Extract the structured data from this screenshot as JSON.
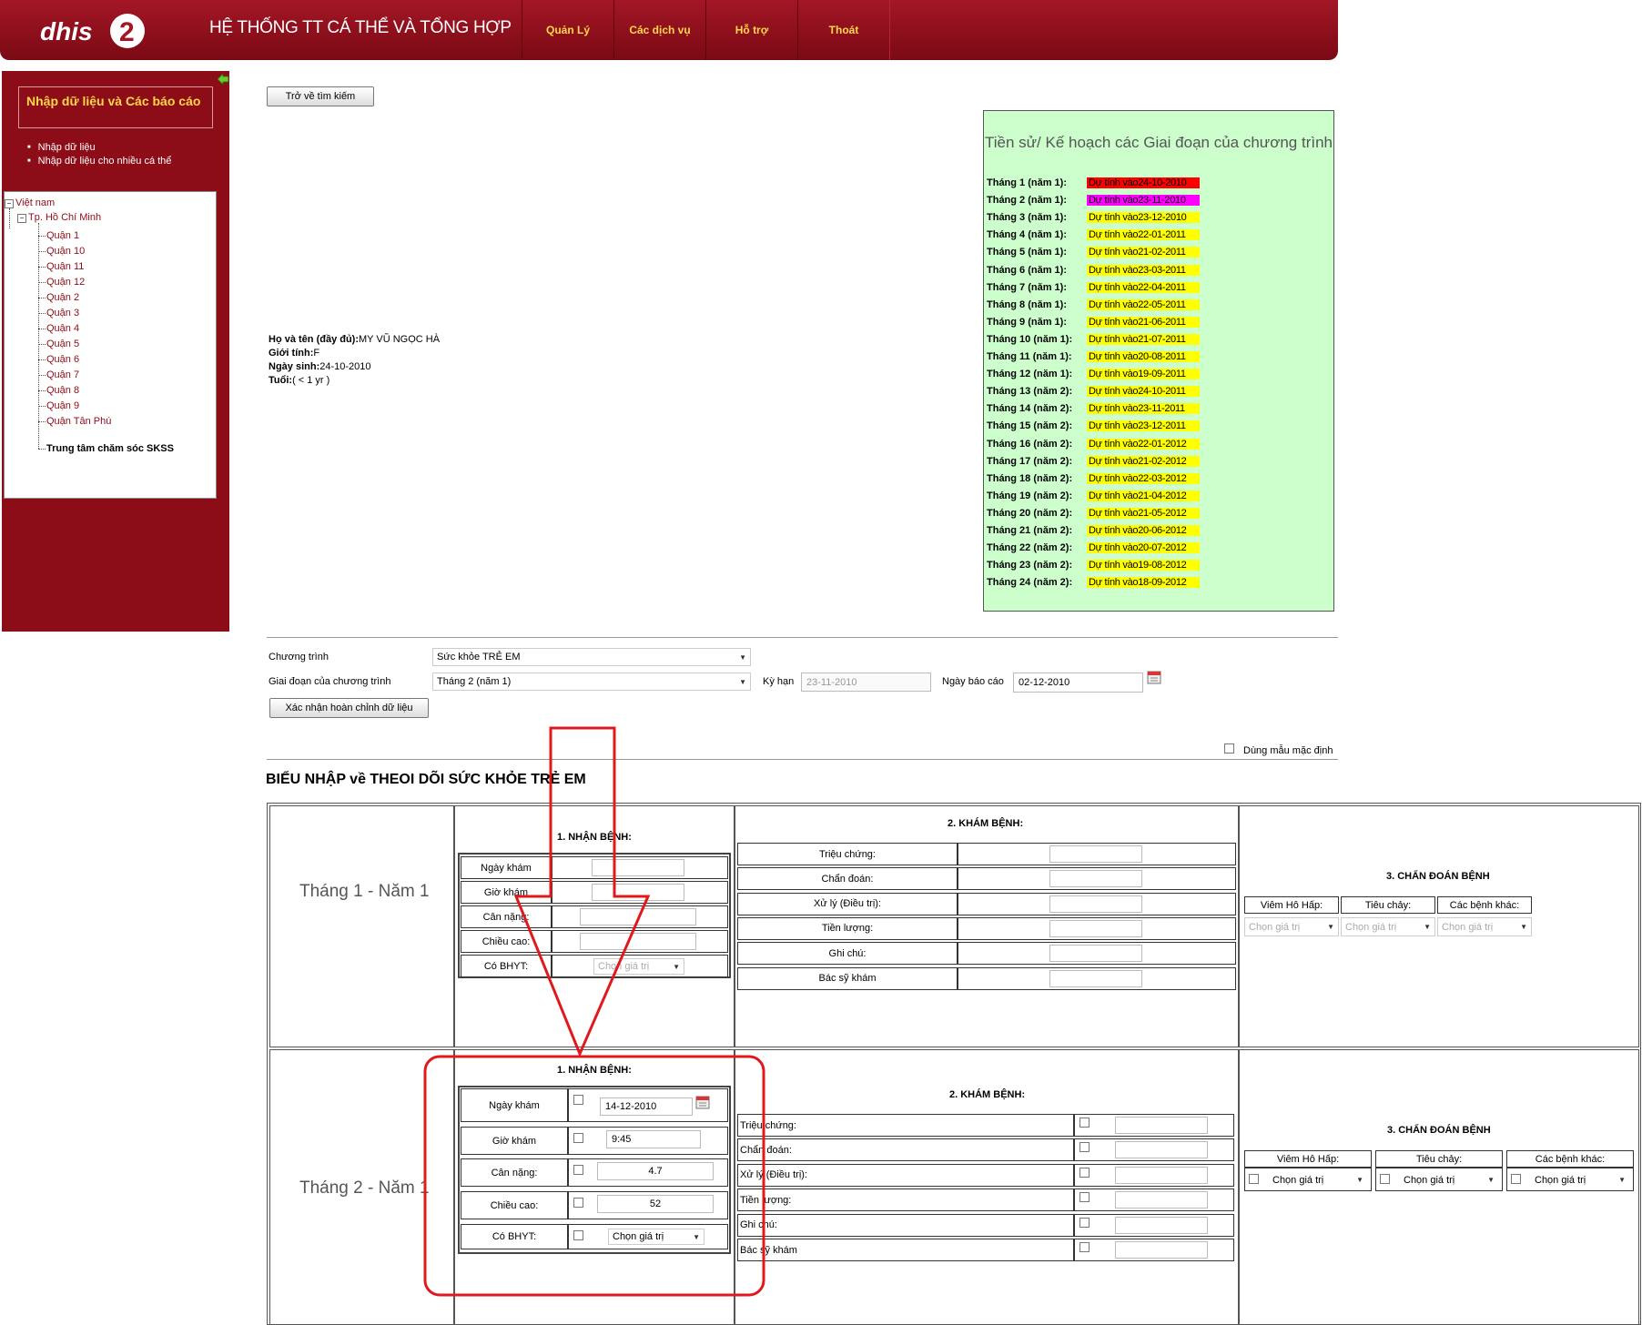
{
  "header": {
    "logo_text": "dhis2",
    "app_title": "HỆ THỐNG TT CÁ THỂ VÀ TỔNG HỢP",
    "menu": [
      "Quản Lý",
      "Các dịch vụ",
      "Hỗ trợ",
      "Thoát"
    ]
  },
  "sidebar": {
    "heading": "Nhập dữ liệu và Các báo cáo",
    "links": [
      "Nhập dữ liệu",
      "Nhập dữ liệu cho nhiều cá thể"
    ],
    "tree": {
      "root": "Việt nam",
      "city": "Tp. Hồ Chí Minh",
      "districts": [
        "Quận 1",
        "Quận 10",
        "Quận 11",
        "Quận 12",
        "Quận 2",
        "Quận 3",
        "Quận 4",
        "Quận 5",
        "Quận 6",
        "Quận 7",
        "Quận 8",
        "Quận 9",
        "Quận Tân Phú"
      ],
      "selected": "Trung tâm chăm sóc SKSS"
    }
  },
  "back_button": "Trở về tìm kiếm",
  "patient": {
    "name_label": "Họ và tên (đầy đủ):",
    "name": "MY VŨ NGỌC HÀ",
    "gender_label": "Giới tính:",
    "gender": "F",
    "dob_label": "Ngày sinh:",
    "dob": "24-10-2010",
    "age_label": "Tuổi:",
    "age": "( < 1 yr )"
  },
  "schedule": {
    "title": "Tiền sử/ Kế hoạch các Giai đoạn của chương trình",
    "items": [
      {
        "label": "Tháng 1 (năm 1):",
        "value": "Dự tính vào24-10-2010",
        "color": "#ff0000"
      },
      {
        "label": "Tháng 2 (năm 1):",
        "value": "Dự tính vào23-11-2010",
        "color": "#ff00ff"
      },
      {
        "label": "Tháng 3 (năm 1):",
        "value": "Dự tính vào23-12-2010",
        "color": "#ffff00"
      },
      {
        "label": "Tháng 4 (năm 1):",
        "value": "Dự tính vào22-01-2011",
        "color": "#ffff00"
      },
      {
        "label": "Tháng 5 (năm 1):",
        "value": "Dự tính vào21-02-2011",
        "color": "#ffff00"
      },
      {
        "label": "Tháng 6 (năm 1):",
        "value": "Dự tính vào23-03-2011",
        "color": "#ffff00"
      },
      {
        "label": "Tháng 7 (năm 1):",
        "value": "Dự tính vào22-04-2011",
        "color": "#ffff00"
      },
      {
        "label": "Tháng 8 (năm 1):",
        "value": "Dự tính vào22-05-2011",
        "color": "#ffff00"
      },
      {
        "label": "Tháng 9 (năm 1):",
        "value": "Dự tính vào21-06-2011",
        "color": "#ffff00"
      },
      {
        "label": "Tháng 10 (năm 1):",
        "value": "Dự tính vào21-07-2011",
        "color": "#ffff00"
      },
      {
        "label": "Tháng 11 (năm 1):",
        "value": "Dự tính vào20-08-2011",
        "color": "#ffff00"
      },
      {
        "label": "Tháng 12 (năm 1):",
        "value": "Dự tính vào19-09-2011",
        "color": "#ffff00"
      },
      {
        "label": "Tháng 13 (năm 2):",
        "value": "Dự tính vào24-10-2011",
        "color": "#ffff00"
      },
      {
        "label": "Tháng 14 (năm 2):",
        "value": "Dự tính vào23-11-2011",
        "color": "#ffff00"
      },
      {
        "label": "Tháng 15 (năm 2):",
        "value": "Dự tính vào23-12-2011",
        "color": "#ffff00"
      },
      {
        "label": "Tháng 16 (năm 2):",
        "value": "Dự tính vào22-01-2012",
        "color": "#ffff00"
      },
      {
        "label": "Tháng 17 (năm 2):",
        "value": "Dự tính vào21-02-2012",
        "color": "#ffff00"
      },
      {
        "label": "Tháng 18 (năm 2):",
        "value": "Dự tính vào22-03-2012",
        "color": "#ffff00"
      },
      {
        "label": "Tháng 19 (năm 2):",
        "value": "Dự tính vào21-04-2012",
        "color": "#ffff00"
      },
      {
        "label": "Tháng 20 (năm 2):",
        "value": "Dự tính vào21-05-2012",
        "color": "#ffff00"
      },
      {
        "label": "Tháng 21 (năm 2):",
        "value": "Dự tính vào20-06-2012",
        "color": "#ffff00"
      },
      {
        "label": "Tháng 22 (năm 2):",
        "value": "Dự tính vào20-07-2012",
        "color": "#ffff00"
      },
      {
        "label": "Tháng 23 (năm 2):",
        "value": "Dự tính vào19-08-2012",
        "color": "#ffff00"
      },
      {
        "label": "Tháng 24 (năm 2):",
        "value": "Dự tính vào18-09-2012",
        "color": "#ffff00"
      }
    ]
  },
  "program": {
    "program_label": "Chương trình",
    "program_value": "Sức khỏe TRẺ EM",
    "stage_label": "Giai đoạn của chương trình",
    "stage_value": "Tháng 2 (năm 1)",
    "due_label": "Kỳ hạn",
    "due_value": "23-11-2010",
    "report_label": "Ngày báo cáo",
    "report_value": "02-12-2010",
    "complete_button": "Xác nhận hoàn chỉnh dữ liệu",
    "default_form_label": "Dùng mẫu mặc định"
  },
  "form": {
    "title": "BIỂU NHẬP về THEOI DÕI SỨC KHỎE TRẺ EM",
    "section1": "1. NHẬN BỆNH:",
    "section2": "2. KHÁM BỆNH:",
    "section3": "3. CHẨN ĐOÁN BỆNH",
    "intake_fields": [
      "Ngày khám",
      "Giờ khám",
      "Cân nặng:",
      "Chiều cao:",
      "Có BHYT:"
    ],
    "exam_fields": [
      "Triệu chứng:",
      "Chẩn đoán:",
      "Xử lý (Điều trị):",
      "Tiền lượng:",
      "Ghi chú:",
      "Bác sỹ khám"
    ],
    "diag_fields": [
      "Viêm Hô Hấp:",
      "Tiêu chảy:",
      "Các bệnh khác:"
    ],
    "select_placeholder": "Chọn giá trị",
    "rows": [
      {
        "label": "Tháng 1 - Năm 1"
      },
      {
        "label": "Tháng 2 - Năm 1",
        "intake_values": [
          "14-12-2010",
          "9:45",
          "4.7",
          "52"
        ]
      }
    ]
  }
}
